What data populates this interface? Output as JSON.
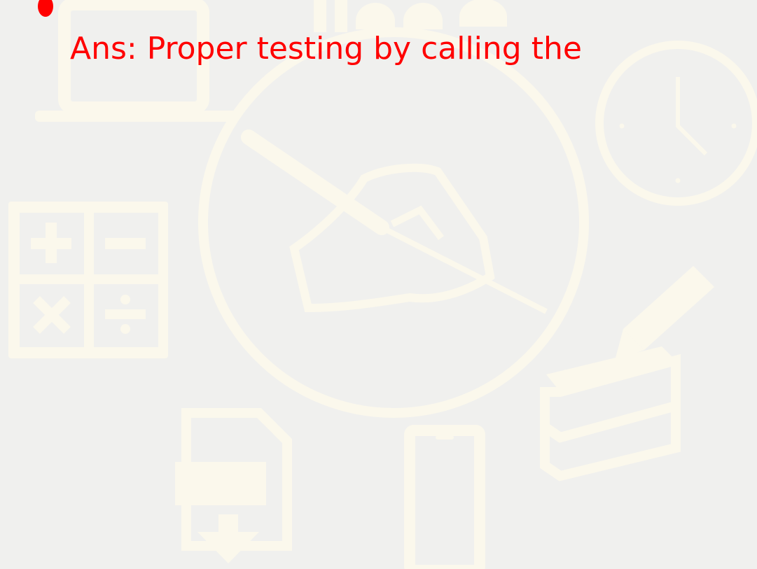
{
  "slide": {
    "answer_text": "Ans: Proper testing by calling the"
  },
  "colors": {
    "background": "#f0f0ee",
    "text": "#ff0000",
    "watermark": "#fbf8ec"
  },
  "icons": [
    "laptop-icon",
    "bar-chart-icon",
    "clock-icon",
    "writing-hand-icon",
    "calculator-icon",
    "pencil-icon",
    "books-icon",
    "pdf-download-icon",
    "smartphone-icon"
  ]
}
